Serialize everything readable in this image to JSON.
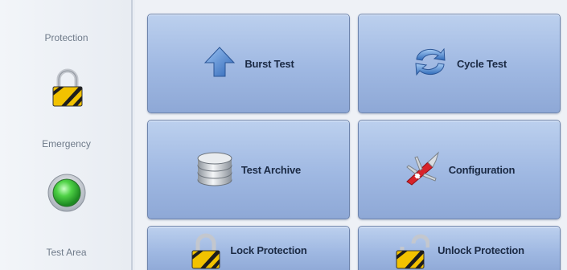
{
  "sidebar": {
    "protection_label": "Protection",
    "emergency_label": "Emergency",
    "test_area_label": "Test Area"
  },
  "tiles": {
    "burst_test": "Burst Test",
    "cycle_test": "Cycle Test",
    "test_archive": "Test Archive",
    "configuration": "Configuration",
    "lock_protection": "Lock Protection",
    "unlock_protection": "Unlock Protection"
  },
  "icons": {
    "protection_status": "padlock-locked-icon",
    "emergency_status": "green-led-icon",
    "burst_test": "up-arrow-icon",
    "cycle_test": "cycle-arrows-icon",
    "test_archive": "database-stack-icon",
    "configuration": "swiss-army-knife-icon",
    "lock_protection": "padlock-locked-icon",
    "unlock_protection": "padlock-open-icon"
  },
  "colors": {
    "tile_top": "#bcd0ee",
    "tile_bottom": "#8ea8d6",
    "emergency_led": "#33c23a",
    "hazard_yellow": "#f2c200"
  }
}
